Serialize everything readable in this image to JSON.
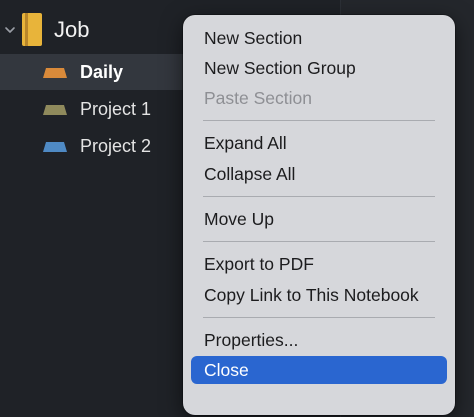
{
  "notebook": {
    "title": "Job",
    "icon": "notebook-icon",
    "icon_color": "#e8b43a"
  },
  "sections": [
    {
      "label": "Daily",
      "color": "#d98a3a",
      "selected": true
    },
    {
      "label": "Project 1",
      "color": "#8f8a5c",
      "selected": false
    },
    {
      "label": "Project 2",
      "color": "#4f8ac4",
      "selected": false
    }
  ],
  "context_menu": {
    "items": [
      {
        "label": "New Section",
        "enabled": true
      },
      {
        "label": "New Section Group",
        "enabled": true
      },
      {
        "label": "Paste Section",
        "enabled": false
      },
      {
        "label": "Expand All",
        "enabled": true
      },
      {
        "label": "Collapse All",
        "enabled": true
      },
      {
        "label": "Move Up",
        "enabled": true
      },
      {
        "label": "Export to PDF",
        "enabled": true
      },
      {
        "label": "Copy Link to This Notebook",
        "enabled": true
      },
      {
        "label": "Properties...",
        "enabled": true
      },
      {
        "label": "Close",
        "enabled": true,
        "highlighted": true
      }
    ]
  },
  "colors": {
    "sidebar_bg": "#1f2227",
    "selected_row_bg": "#33373e",
    "menu_bg": "#d6d7db",
    "menu_highlight": "#2a66d0"
  }
}
